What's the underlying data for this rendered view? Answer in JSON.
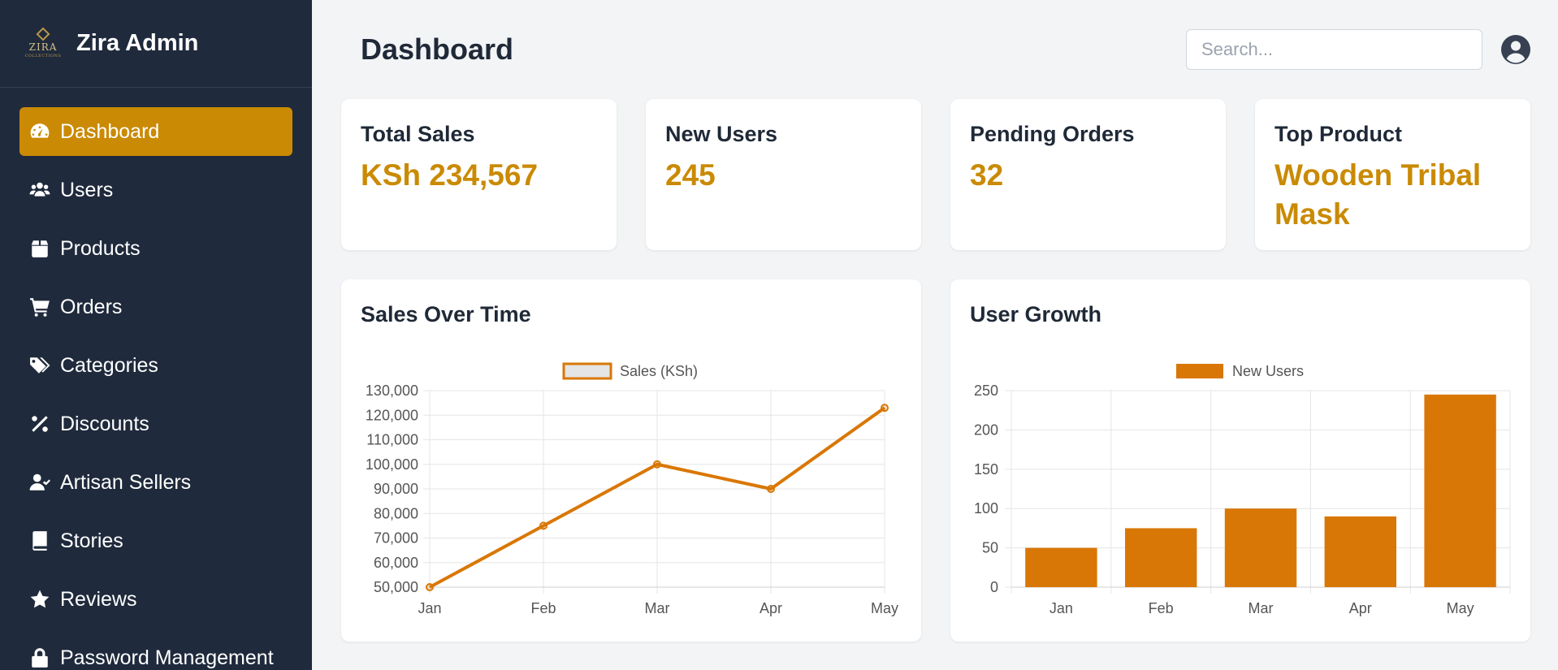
{
  "brand": {
    "logo_text": "ZIRA",
    "logo_subtext": "COLLECTIONS",
    "title": "Zira Admin"
  },
  "sidebar": {
    "items": [
      {
        "label": "Dashboard",
        "icon": "gauge-icon",
        "active": true
      },
      {
        "label": "Users",
        "icon": "users-icon",
        "active": false
      },
      {
        "label": "Products",
        "icon": "box-icon",
        "active": false
      },
      {
        "label": "Orders",
        "icon": "cart-icon",
        "active": false
      },
      {
        "label": "Categories",
        "icon": "tags-icon",
        "active": false
      },
      {
        "label": "Discounts",
        "icon": "percent-icon",
        "active": false
      },
      {
        "label": "Artisan Sellers",
        "icon": "user-check-icon",
        "active": false
      },
      {
        "label": "Stories",
        "icon": "book-icon",
        "active": false
      },
      {
        "label": "Reviews",
        "icon": "star-icon",
        "active": false
      },
      {
        "label": "Password Management",
        "icon": "lock-icon",
        "active": false
      }
    ]
  },
  "header": {
    "title": "Dashboard",
    "search_placeholder": "Search..."
  },
  "stats": [
    {
      "label": "Total Sales",
      "value": "KSh 234,567"
    },
    {
      "label": "New Users",
      "value": "245"
    },
    {
      "label": "Pending Orders",
      "value": "32"
    },
    {
      "label": "Top Product",
      "value": "Wooden Tribal Mask"
    }
  ],
  "colors": {
    "sidebar_bg": "#1f2a3c",
    "accent": "#ca8a04",
    "chart": "#d97706"
  },
  "chart_data": [
    {
      "type": "line",
      "title": "Sales Over Time",
      "categories": [
        "Jan",
        "Feb",
        "Mar",
        "Apr",
        "May"
      ],
      "series": [
        {
          "name": "Sales (KSh)",
          "values": [
            50000,
            75000,
            100000,
            90000,
            123000
          ]
        }
      ],
      "ylim": [
        50000,
        130000
      ],
      "yticks": [
        "50,000",
        "60,000",
        "70,000",
        "80,000",
        "90,000",
        "100,000",
        "110,000",
        "120,000",
        "130,000"
      ],
      "grid": true,
      "legend": "top"
    },
    {
      "type": "bar",
      "title": "User Growth",
      "categories": [
        "Jan",
        "Feb",
        "Mar",
        "Apr",
        "May"
      ],
      "series": [
        {
          "name": "New Users",
          "values": [
            50,
            75,
            100,
            90,
            245
          ]
        }
      ],
      "ylim": [
        0,
        250
      ],
      "yticks": [
        "0",
        "50",
        "100",
        "150",
        "200",
        "250"
      ],
      "grid": true,
      "legend": "top"
    }
  ]
}
